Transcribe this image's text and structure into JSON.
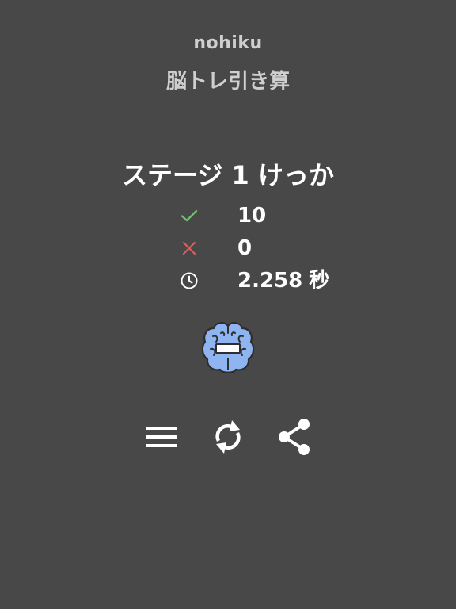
{
  "header": {
    "app_name": "nohiku",
    "subtitle": "脳トレ引き算"
  },
  "result": {
    "title": "ステージ 1 けっか",
    "stats": [
      {
        "icon": "check-icon",
        "value": "10",
        "color": "#67c46b"
      },
      {
        "icon": "cross-icon",
        "value": "0",
        "color": "#d9605e"
      },
      {
        "icon": "clock-icon",
        "value": "2.258",
        "unit": "秒",
        "color": "#ffffff"
      }
    ]
  },
  "mascot": {
    "icon": "brain-minus-icon",
    "color": "#8fb4f2"
  },
  "actions": [
    {
      "icon": "menu-icon"
    },
    {
      "icon": "retry-icon"
    },
    {
      "icon": "share-icon"
    }
  ],
  "colors": {
    "background": "#484848",
    "text": "#ffffff",
    "header_text": "#cfcfcf"
  }
}
